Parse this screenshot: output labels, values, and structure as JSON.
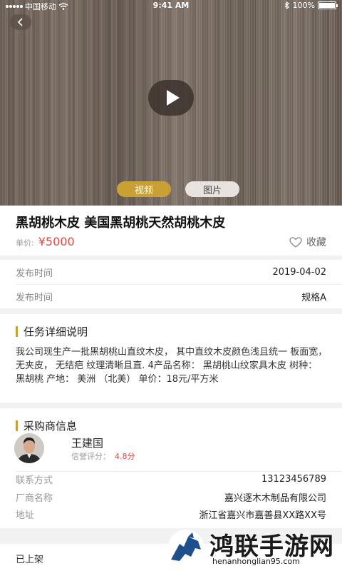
{
  "status_bar": {
    "carrier": "中国移动",
    "time": "9:41 AM",
    "battery": "100%",
    "battery_level": 1.0
  },
  "media": {
    "tabs": [
      {
        "label": "视频",
        "active": true
      },
      {
        "label": "图片",
        "active": false
      }
    ]
  },
  "product": {
    "title": "黑胡桃木皮 美国黑胡桃天然胡桃木皮",
    "price_label": "单价:",
    "price": "¥5000",
    "favorite_label": "收藏"
  },
  "info": {
    "rows": [
      {
        "label": "发布时间",
        "value": "2019-04-02"
      },
      {
        "label": "发布时间",
        "value": "规格A"
      }
    ]
  },
  "detail": {
    "heading": "任务详细说明",
    "text": "我公司现生产一批黑胡桃山直纹木皮， 其中直纹木皮颜色浅且统一 板面宽， 无夹皮， 无结疤 纹理清晰且直. 4产品名称： 黑胡桃山纹家具木皮 树种： 黑胡桃 产地： 美洲 （北美） 单价：18元/平方米"
  },
  "buyer": {
    "heading": "采购商信息",
    "name": "王建国",
    "credit_label": "信誉评分：",
    "credit_score": "4.8分",
    "rows": [
      {
        "label": "联系方式",
        "value": "13123456789"
      },
      {
        "label": "厂商名称",
        "value": "嘉兴逐木木制品有限公司"
      },
      {
        "label": "地址",
        "value": "浙江省嘉兴市嘉善县XX路XX号"
      }
    ]
  },
  "bottom": {
    "status": "已上架"
  },
  "watermark": {
    "text": "鸿联手游网",
    "url": "henanhonglian95.com"
  },
  "colors": {
    "accent": "#c9a033",
    "price": "#e8463f"
  }
}
